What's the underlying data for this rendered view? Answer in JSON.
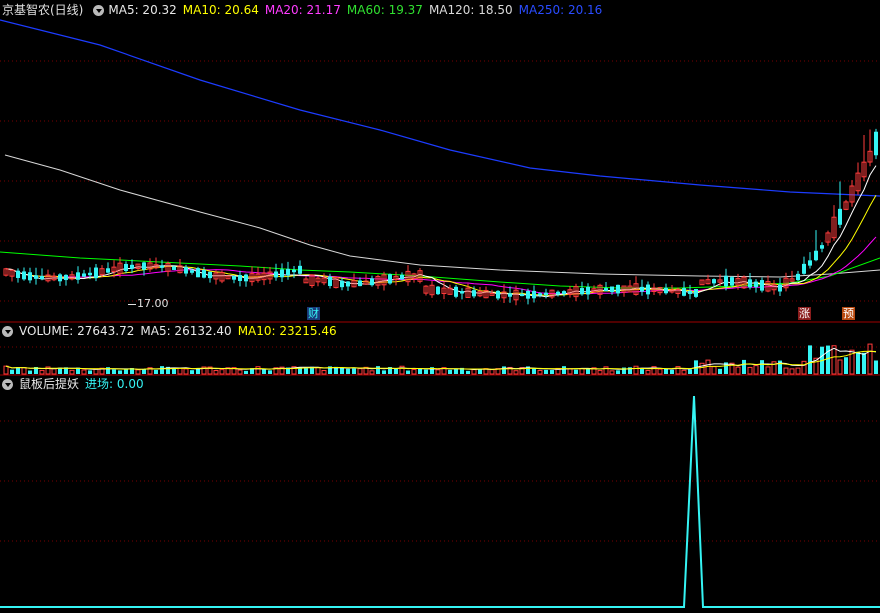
{
  "colors": {
    "background": "#000000",
    "grid": "#7a0000",
    "up": "#ff3b3b",
    "down": "#35f4f4",
    "ma5": "#ffffff",
    "ma10": "#ffff00",
    "ma20": "#ff00ff",
    "ma60": "#00ff00",
    "ma120": "#d8d8d8",
    "ma250": "#1c3cff",
    "indicator": "#35f4f4",
    "label_white": "#e0e0e0"
  },
  "price_panel": {
    "stock_name": "京基智农(日线)",
    "ma5_label": "MA5: 20.32",
    "ma10_label": "MA10: 20.64",
    "ma20_label": "MA20: 21.17",
    "ma60_label": "MA60: 19.37",
    "ma120_label": "MA120: 18.50",
    "ma250_label": "MA250: 20.16",
    "low_marker": "17.00",
    "markers": [
      {
        "text": "财",
        "color": "#35f4f4",
        "bg": "#1a3a7a"
      },
      {
        "text": "涨",
        "color": "#ffffff",
        "bg": "#a02020"
      },
      {
        "text": "预",
        "color": "#ffffff",
        "bg": "#c05010"
      }
    ]
  },
  "volume_panel": {
    "volume_label": "VOLUME: 27643.72",
    "ma5_label": "MA5: 26132.40",
    "ma10_label": "MA10: 23215.46"
  },
  "indicator_panel": {
    "name": "鼠板后提妖",
    "entry_label": "进场: 0.00"
  },
  "chart_data": {
    "type": "candlestick",
    "title": "京基智农(日线)",
    "marked_low": 17.0,
    "moving_averages_last": {
      "MA5": 20.32,
      "MA10": 20.64,
      "MA20": 21.17,
      "MA60": 19.37,
      "MA120": 18.5,
      "MA250": 20.16
    },
    "volume_last": 27643.72,
    "volume_ma5": 26132.4,
    "volume_ma10": 23215.46,
    "indicator_last": 0.0
  }
}
